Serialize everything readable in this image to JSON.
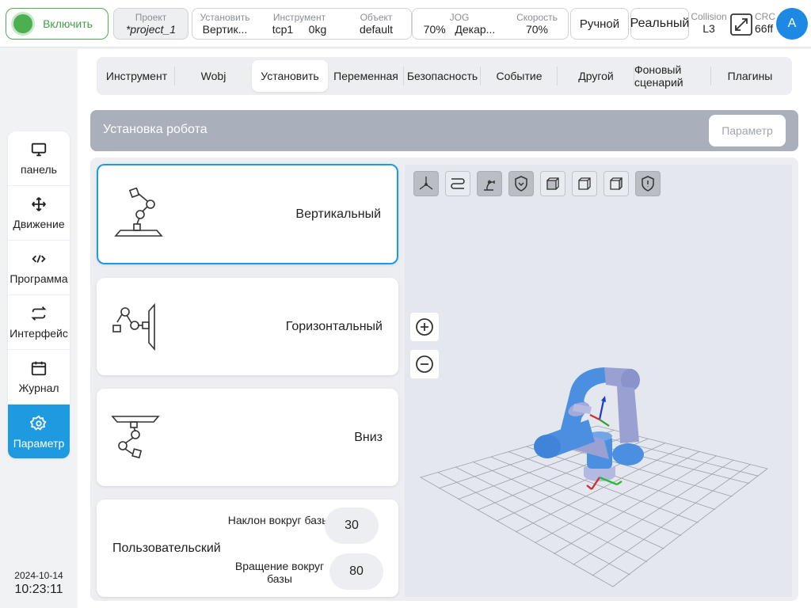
{
  "topbar": {
    "enable_label": "Включить",
    "project": {
      "caption": "Проект",
      "value": "*project_1"
    },
    "setup": {
      "caption": "Установить",
      "value": "Вертик..."
    },
    "tool": {
      "caption": "Инструмент",
      "value": "tcp1",
      "payload": "0kg"
    },
    "wobj": {
      "caption": "Объект",
      "value": "default"
    },
    "jog": {
      "caption": "JOG",
      "value": "70%",
      "frame": "Декар..."
    },
    "speed": {
      "caption": "Скорость",
      "value": "70%"
    },
    "mode_label": "Ручной",
    "env_label": "Реальный",
    "collision": {
      "caption": "Collision",
      "value": "L3"
    },
    "crc": {
      "caption": "CRC",
      "value": "66ff"
    },
    "avatar_letter": "A"
  },
  "sidebar": {
    "items": [
      {
        "label": "панель",
        "icon": "monitor-icon"
      },
      {
        "label": "Движение",
        "icon": "move-icon"
      },
      {
        "label": "Программа",
        "icon": "code-icon"
      },
      {
        "label": "Интерфейс",
        "icon": "swap-icon"
      },
      {
        "label": "Журнал",
        "icon": "calendar-icon"
      },
      {
        "label": "Параметр",
        "icon": "gear-icon",
        "active": true
      }
    ],
    "date": "2024-10-14",
    "time": "10:23:11"
  },
  "tabs": [
    {
      "label": "Инструмент"
    },
    {
      "label": "Wobj"
    },
    {
      "label": "Установить",
      "active": true
    },
    {
      "label": "Переменная"
    },
    {
      "label": "Безопасность"
    },
    {
      "label": "Событие"
    },
    {
      "label": "Другой"
    },
    {
      "label": "Фоновый сценарий"
    },
    {
      "label": "Плагины"
    }
  ],
  "header": {
    "title": "Установка робота",
    "param_button": "Параметр"
  },
  "mounting": {
    "vertical": "Вертикальный",
    "horizontal": "Горизонтальный",
    "down": "Вниз",
    "custom": {
      "label": "Пользовательский",
      "tilt_label": "Наклон вокруг базы",
      "tilt_value": "30",
      "rotation_label": "Вращение вокруг базы",
      "rotation_value": "80"
    }
  },
  "colors": {
    "accent": "#1e9be0",
    "enable": "#4caf50",
    "robot": "#4a8fe0",
    "robot_joint": "#a6acd8"
  }
}
